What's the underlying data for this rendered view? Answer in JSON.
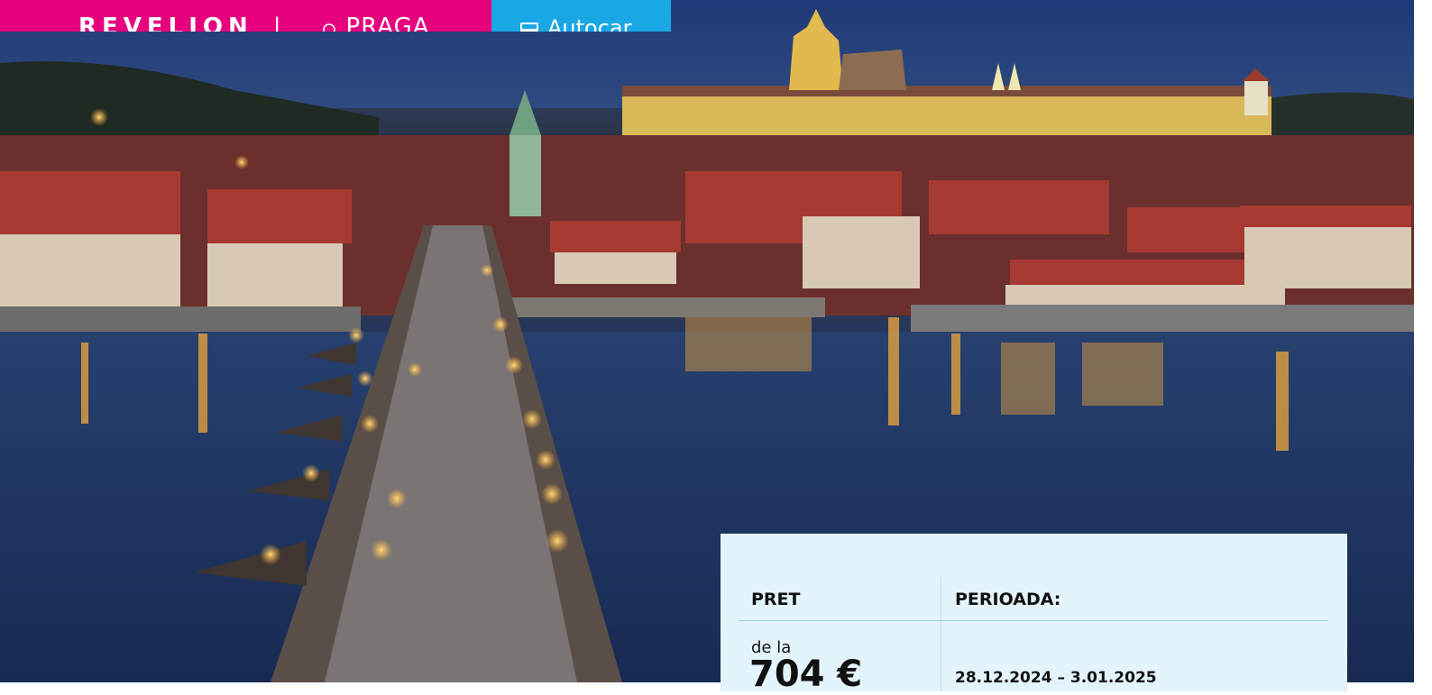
{
  "header": {
    "brand": "REVELION",
    "separator": "|",
    "destination": "PRAGA",
    "transport": "Autocar",
    "pin_icon": "map-pin-icon",
    "bus_icon": "bus-icon",
    "colors": {
      "pink": "#e6007e",
      "blue": "#1aa7e6"
    }
  },
  "hero": {
    "photo": "Prague night view over Charles Bridge and Vltava river"
  },
  "info_card": {
    "price_header": "PRET",
    "period_header": "PERIOADA:",
    "price_prefix": "de la",
    "price_value": "704 €",
    "period_value": "28.12.2024 – 3.01.2025",
    "background": "#e4f4fc"
  }
}
